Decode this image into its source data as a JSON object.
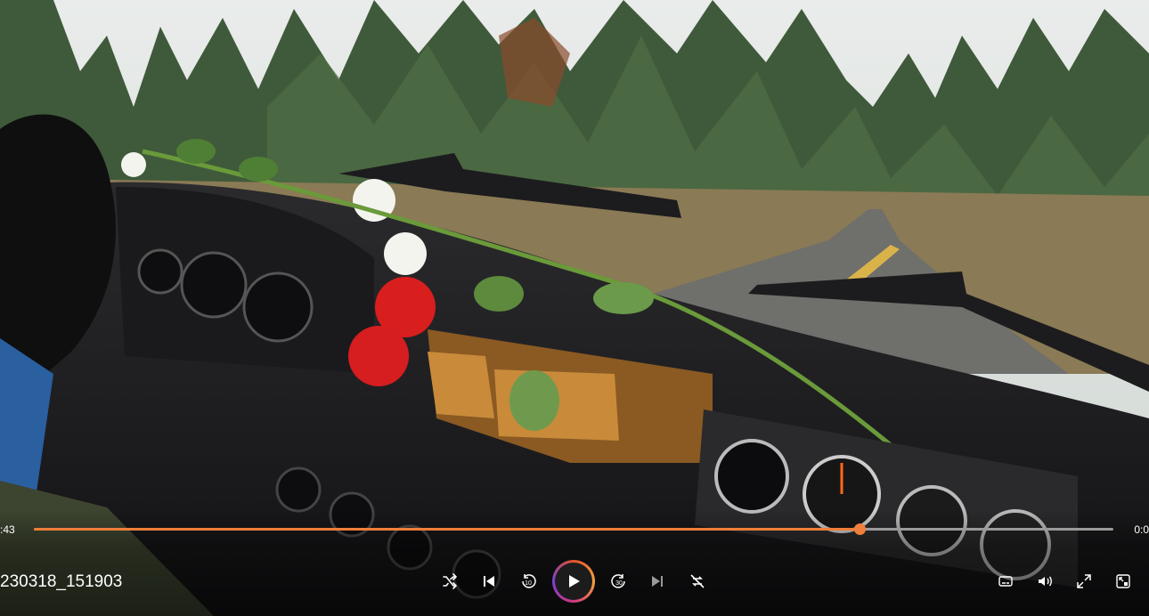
{
  "player": {
    "elapsed": ":43",
    "remaining": "0:0",
    "progress": 0.765,
    "accent": "#ef7f3a",
    "file_name": "230318_151903"
  },
  "controls": [
    {
      "name": "shuffle-icon"
    },
    {
      "name": "skip-previous-icon"
    },
    {
      "name": "rewind-10-icon"
    },
    {
      "name": "play-icon"
    },
    {
      "name": "forward-30-icon"
    },
    {
      "name": "skip-next-icon"
    },
    {
      "name": "repeat-off-icon"
    },
    {
      "name": "subtitles-icon"
    },
    {
      "name": "volume-icon"
    },
    {
      "name": "fullscreen-icon"
    },
    {
      "name": "mini-player-icon"
    }
  ],
  "labels": {
    "rewind": "10",
    "forward": "30"
  }
}
